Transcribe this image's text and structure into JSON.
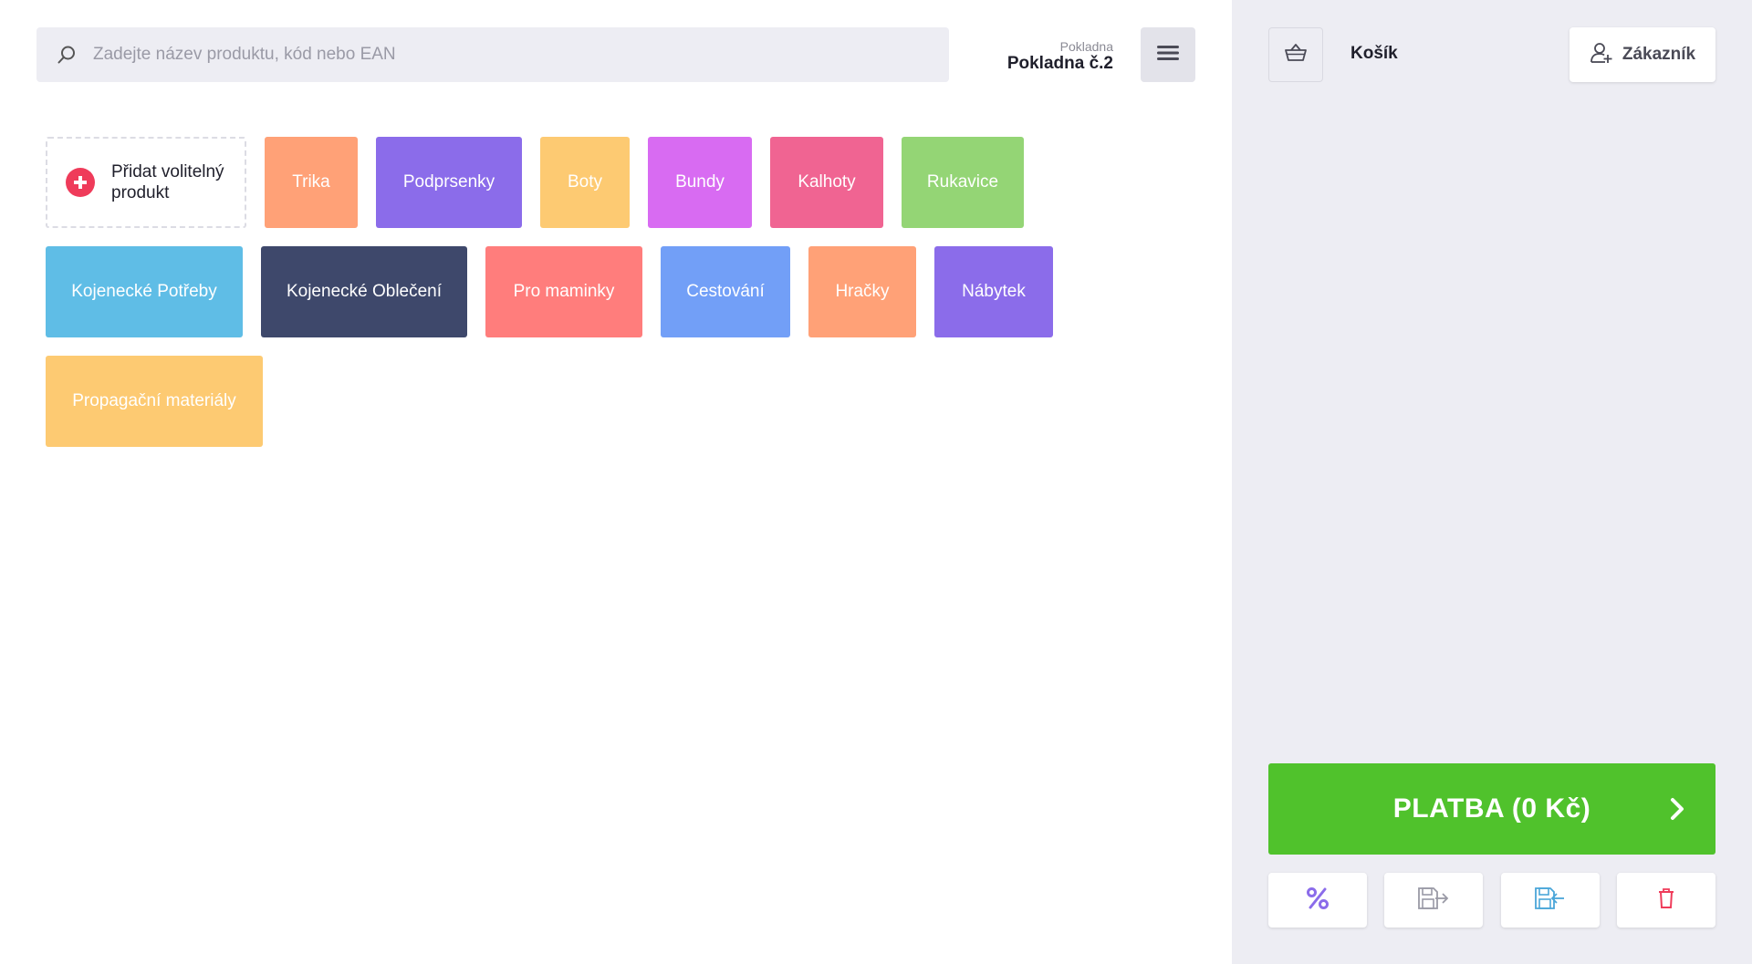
{
  "search": {
    "placeholder": "Zadejte název produktu, kód nebo EAN",
    "icon": "search-icon"
  },
  "register": {
    "caption": "Pokladna",
    "name": "Pokladna č.2"
  },
  "menu": {
    "icon": "hamburger-menu-icon"
  },
  "add_product": {
    "label_line1": "Přidat volitelný",
    "label_line2": "produkt",
    "icon": "plus-circle-icon",
    "icon_color": "#ef3b5a"
  },
  "categories": [
    {
      "label": "Trika",
      "color": "#ffa177"
    },
    {
      "label": "Podprsenky",
      "color": "#8b6cea"
    },
    {
      "label": "Boty",
      "color": "#fdca72"
    },
    {
      "label": "Bundy",
      "color": "#d86bf2"
    },
    {
      "label": "Kalhoty",
      "color": "#f06492"
    },
    {
      "label": "Rukavice",
      "color": "#94d575"
    },
    {
      "label": "Kojenecké Potřeby",
      "color": "#5fbde6"
    },
    {
      "label": "Kojenecké Oblečení",
      "color": "#3e486b"
    },
    {
      "label": "Pro maminky",
      "color": "#ff7d7c"
    },
    {
      "label": "Cestování",
      "color": "#729ff7"
    },
    {
      "label": "Hračky",
      "color": "#ffa177"
    },
    {
      "label": "Nábytek",
      "color": "#8b6cea"
    },
    {
      "label": "Propagační materiály",
      "color": "#fdca72"
    }
  ],
  "cart": {
    "title": "Košík",
    "basket_icon": "basket-icon",
    "customer_label": "Zákazník",
    "customer_icon": "add-user-icon"
  },
  "payment": {
    "label": "PLATBA (0 Kč)",
    "color": "#50c22c",
    "icon": "chevron-right-icon"
  },
  "actions": [
    {
      "icon": "percent-discount-icon",
      "color": "#8b6cea"
    },
    {
      "icon": "save-export-icon",
      "color": "#9a9aa6"
    },
    {
      "icon": "save-import-icon",
      "color": "#4aa6d9"
    },
    {
      "icon": "trash-icon",
      "color": "#ef3b5a"
    }
  ]
}
